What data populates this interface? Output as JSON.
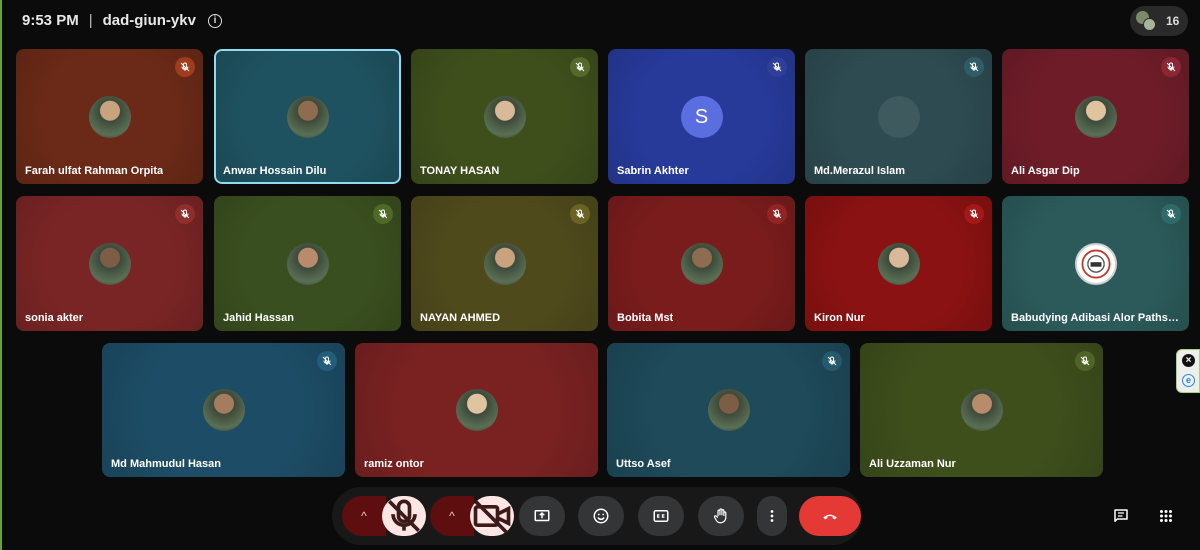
{
  "meeting": {
    "time": "9:53 PM",
    "separator": "|",
    "code": "dad-giun-ykv",
    "info_glyph": "i"
  },
  "people_count": "16",
  "tiles": [
    {
      "name": "Farah ulfat Rahman Orpita",
      "bg": "#6b2a17",
      "avatar": "photo",
      "mute_color": "#a03b1e"
    },
    {
      "name": "Anwar Hossain Dilu",
      "bg": "#1f5260",
      "avatar": "photo",
      "mute_color": "none",
      "active": true
    },
    {
      "name": "TONAY HASAN",
      "bg": "#3e4f1c",
      "avatar": "photo",
      "mute_color": "#556a2a"
    },
    {
      "name": "Sabrin Akhter",
      "bg": "#273a9a",
      "avatar": "initial",
      "initial": "S",
      "mute_color": "#2f3f98"
    },
    {
      "name": "Md.Merazul Islam",
      "bg": "#2d4b51",
      "avatar": "blank",
      "mute_color": "#2f5d66"
    },
    {
      "name": "Ali Asgar Dip",
      "bg": "#6e1d28",
      "avatar": "photo",
      "mute_color": "#8a2734"
    },
    {
      "name": "sonia akter",
      "bg": "#7a2525",
      "avatar": "photo",
      "mute_color": "#902d2d"
    },
    {
      "name": "Jahid Hassan",
      "bg": "#3a4f1f",
      "avatar": "photo",
      "mute_color": "#4d6a26"
    },
    {
      "name": "NAYAN AHMED",
      "bg": "#4f4a1c",
      "avatar": "photo",
      "mute_color": "#6a6324"
    },
    {
      "name": "Bobita Mst",
      "bg": "#7a1c1c",
      "avatar": "photo",
      "mute_color": "#922424"
    },
    {
      "name": "Kiron Nur",
      "bg": "#8a1212",
      "avatar": "photo",
      "mute_color": "#a31818"
    },
    {
      "name": "Babudying Adibasi Alor Paths…",
      "bg": "#2c5a5a",
      "avatar": "logo",
      "mute_color": "#2f6a6a"
    },
    {
      "name": "Md Mahmudul Hasan",
      "bg": "#1d4d66",
      "avatar": "photo",
      "mute_color": "#245d7a"
    },
    {
      "name": "ramiz ontor",
      "bg": "#7a2222",
      "avatar": "photo",
      "mute_color": "none"
    },
    {
      "name": "Uttso Asef",
      "bg": "#1e4a5a",
      "avatar": "photo",
      "mute_color": "#245a6c"
    },
    {
      "name": "Ali Uzzaman Nur",
      "bg": "#3e4f1c",
      "avatar": "photo",
      "mute_color": "#4f6426"
    }
  ],
  "controls": {
    "caret_glyph": "^",
    "leave_color": "#e53935"
  },
  "extension": {
    "close_glyph": "×",
    "logo_glyph": "e"
  },
  "colors": {
    "accent_active": "#8fdcf0",
    "muted_button_bg": "#fde6e4"
  }
}
